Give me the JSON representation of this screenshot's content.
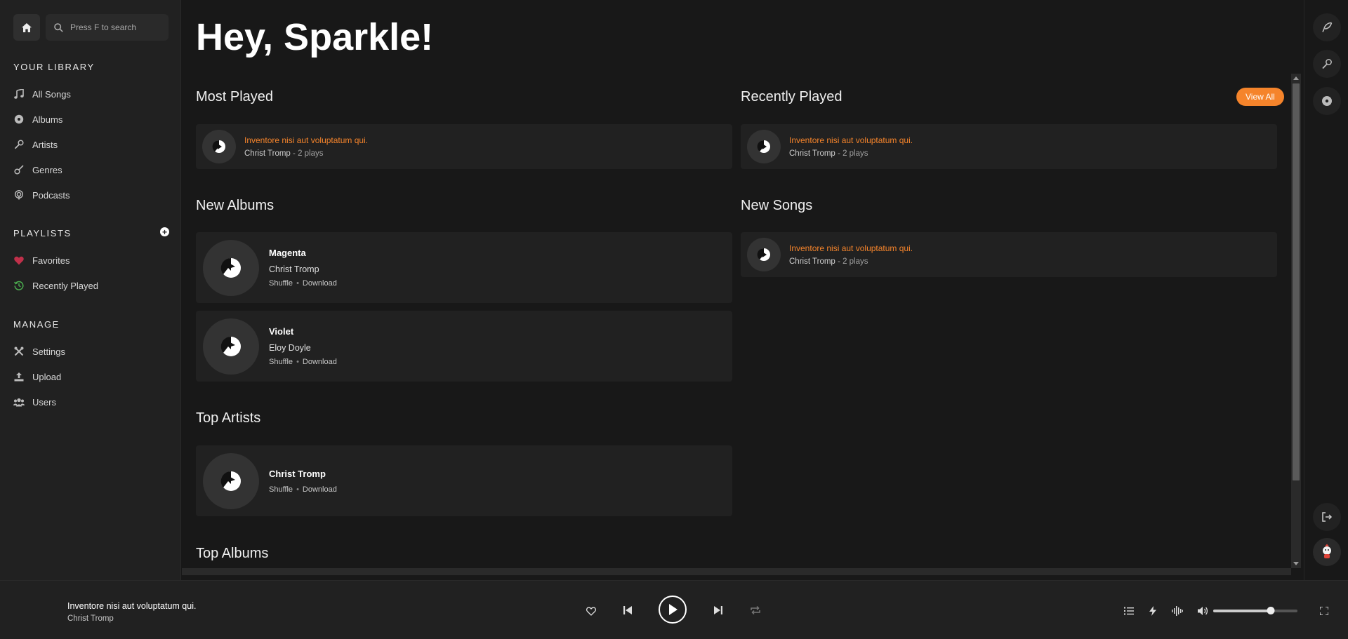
{
  "search": {
    "placeholder": "Press F to search"
  },
  "library": {
    "title": "YOUR LIBRARY",
    "items": [
      {
        "label": "All Songs",
        "icon": "music-note-icon"
      },
      {
        "label": "Albums",
        "icon": "disc-icon"
      },
      {
        "label": "Artists",
        "icon": "microphone-icon"
      },
      {
        "label": "Genres",
        "icon": "guitar-icon"
      },
      {
        "label": "Podcasts",
        "icon": "podcast-icon"
      }
    ]
  },
  "playlists": {
    "title": "PLAYLISTS",
    "items": [
      {
        "label": "Favorites",
        "icon": "heart-icon"
      },
      {
        "label": "Recently Played",
        "icon": "history-icon"
      }
    ]
  },
  "manage": {
    "title": "MANAGE",
    "items": [
      {
        "label": "Settings",
        "icon": "tools-icon"
      },
      {
        "label": "Upload",
        "icon": "upload-icon"
      },
      {
        "label": "Users",
        "icon": "users-icon"
      }
    ]
  },
  "greeting": "Hey, Sparkle!",
  "sections": {
    "most_played": {
      "title": "Most Played",
      "songs": [
        {
          "title": "Inventore nisi aut voluptatum qui.",
          "artist": "Christ Tromp",
          "plays": "2 plays"
        }
      ]
    },
    "recently_played": {
      "title": "Recently Played",
      "view_all": "View All",
      "songs": [
        {
          "title": "Inventore nisi aut voluptatum qui.",
          "artist": "Christ Tromp",
          "plays": "2 plays"
        }
      ]
    },
    "new_albums": {
      "title": "New Albums",
      "albums": [
        {
          "name": "Magenta",
          "artist": "Christ Tromp",
          "shuffle": "Shuffle",
          "download": "Download"
        },
        {
          "name": "Violet",
          "artist": "Eloy Doyle",
          "shuffle": "Shuffle",
          "download": "Download"
        }
      ]
    },
    "new_songs": {
      "title": "New Songs",
      "songs": [
        {
          "title": "Inventore nisi aut voluptatum qui.",
          "artist": "Christ Tromp",
          "plays": "2 plays"
        }
      ]
    },
    "top_artists": {
      "title": "Top Artists",
      "artists": [
        {
          "name": "Christ Tromp",
          "shuffle": "Shuffle",
          "download": "Download"
        }
      ]
    },
    "top_albums": {
      "title": "Top Albums"
    }
  },
  "player": {
    "title": "Inventore nisi aut voluptatum qui.",
    "artist": "Christ Tromp",
    "volume": 0.68
  },
  "colors": {
    "accent": "#f5842b",
    "favorite": "#c0304a",
    "history": "#4caf50"
  }
}
